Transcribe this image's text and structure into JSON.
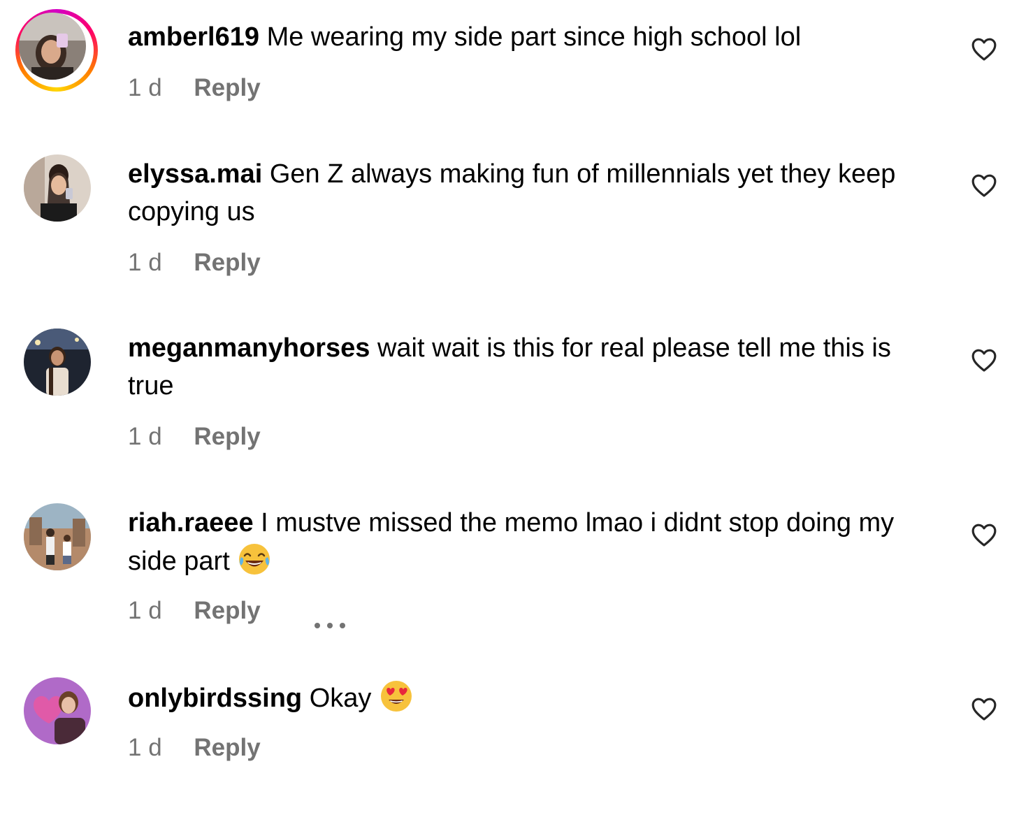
{
  "comments": [
    {
      "username": "amberl619",
      "text": "Me wearing my side part since high school lol",
      "emoji": "",
      "age": "1 d",
      "reply_label": "Reply",
      "has_story_ring": true,
      "has_more": false
    },
    {
      "username": "elyssa.mai",
      "text": "Gen Z always making fun of millennials yet they keep copying us",
      "emoji": "",
      "age": "1 d",
      "reply_label": "Reply",
      "has_story_ring": false,
      "has_more": false
    },
    {
      "username": "meganmanyhorses",
      "text": "wait wait is this for real please tell me this is true",
      "emoji": "",
      "age": "1 d",
      "reply_label": "Reply",
      "has_story_ring": false,
      "has_more": false
    },
    {
      "username": "riah.raeee",
      "text": "I mustve missed the memo lmao i didnt stop doing my side part",
      "emoji": "tears-of-joy-emoji",
      "age": "1 d",
      "reply_label": "Reply",
      "has_story_ring": false,
      "has_more": true
    },
    {
      "username": "onlybirdssing",
      "text": "Okay",
      "emoji": "heart-eyes-emoji",
      "age": "1 d",
      "reply_label": "Reply",
      "has_story_ring": false,
      "has_more": false
    }
  ],
  "icons": {
    "like": "heart-outline-icon",
    "more": "more-options-icon"
  },
  "colors": {
    "text": "#000000",
    "secondary": "#737373",
    "story_ring_start": "#d300c5",
    "story_ring_end": "#ffd600"
  }
}
